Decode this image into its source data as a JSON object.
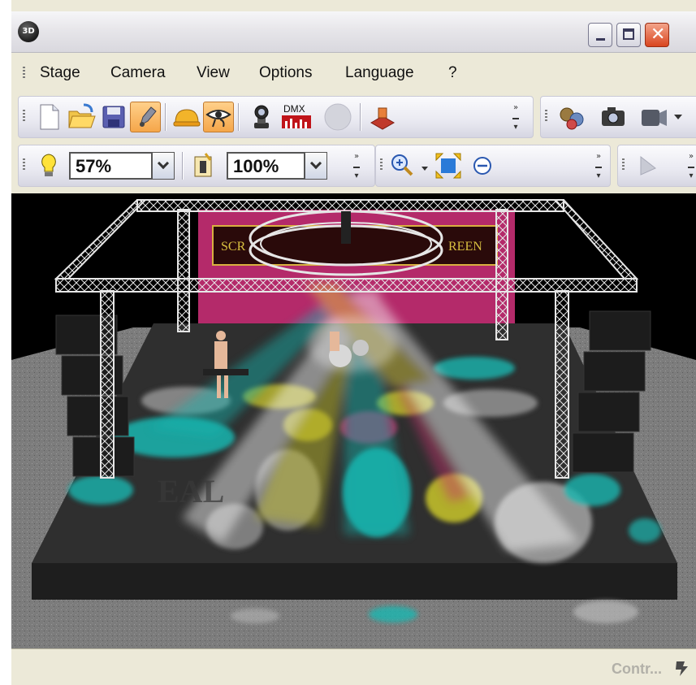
{
  "window": {
    "app_icon_text": "3D",
    "controls": [
      "minimize",
      "maximize",
      "close"
    ],
    "close_glyph": "✕"
  },
  "menu": {
    "items": [
      "Stage",
      "Camera",
      "View",
      "Options",
      "Language",
      "?"
    ]
  },
  "toolbar1": {
    "buttons": [
      {
        "icon": "new-document-icon"
      },
      {
        "icon": "open-folder-icon"
      },
      {
        "icon": "save-disk-icon"
      },
      {
        "icon": "pencil-edit-icon",
        "active": true
      },
      {
        "icon": "hardhat-icon"
      },
      {
        "icon": "eye-view-icon",
        "active": true
      },
      {
        "icon": "moving-head-light-icon"
      },
      {
        "icon": "dmx-icon",
        "label": "DMX"
      },
      {
        "icon": "record-circle-icon"
      },
      {
        "icon": "stamp-icon"
      },
      {
        "icon": "film-reel-icon"
      },
      {
        "icon": "camera-icon"
      },
      {
        "icon": "video-camera-icon"
      }
    ]
  },
  "toolbar2": {
    "light_icon": "lightbulb-icon",
    "brightness_value": "57%",
    "info_icon": "info-card-icon",
    "zoom_value": "100%",
    "zoom_in_icon": "zoom-in-icon",
    "fit_icon": "fit-to-window-icon",
    "zoom_out_icon": "zoom-out-icon",
    "pointer_icon": "pointer-arrow-icon"
  },
  "scene": {
    "screen_text_left": "SCR",
    "screen_text_right": "REEN",
    "colors": {
      "cyan": "#18b6b0",
      "yellow": "#c9c52a",
      "magenta": "#c4306e",
      "white": "#d9d9d9",
      "backdrop": "#b42a6a"
    }
  },
  "status": {
    "text": "Contr...",
    "icon": "status-tool-icon"
  }
}
